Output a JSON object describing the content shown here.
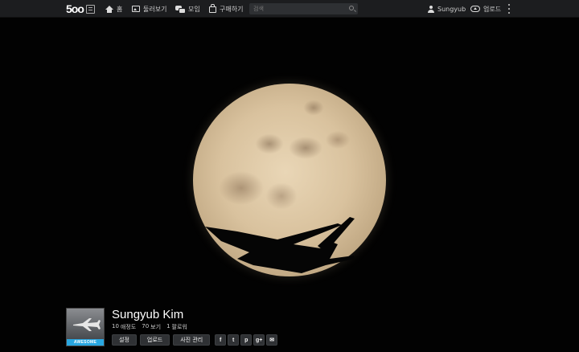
{
  "header": {
    "logo_text": "5oo",
    "nav": [
      {
        "label": "홈",
        "icon": "home-icon"
      },
      {
        "label": "둘러보기",
        "icon": "photo-icon"
      },
      {
        "label": "모임",
        "icon": "chat-icon"
      },
      {
        "label": "구매하기",
        "icon": "bag-icon"
      }
    ],
    "search_placeholder": "검색",
    "user_name": "Sungyub",
    "upload_label": "업로드"
  },
  "profile": {
    "name": "Sungyub Kim",
    "avatar_banner": "AWESOME",
    "stats": [
      {
        "value": "10",
        "label": "애정도"
      },
      {
        "value": "70",
        "label": "보기"
      },
      {
        "value": "1",
        "label": "팔로워"
      }
    ],
    "buttons": [
      "설정",
      "업로드",
      "사진 관리"
    ],
    "social": [
      {
        "glyph": "f",
        "name": "facebook-icon"
      },
      {
        "glyph": "t",
        "name": "twitter-icon"
      },
      {
        "glyph": "p",
        "name": "pinterest-icon"
      },
      {
        "glyph": "g+",
        "name": "google-plus-icon"
      },
      {
        "glyph": "✉",
        "name": "email-icon"
      }
    ]
  },
  "colors": {
    "topbar": "#1c1d1f",
    "accent_banner": "#29a7e1",
    "button_bg": "#2f3134"
  }
}
